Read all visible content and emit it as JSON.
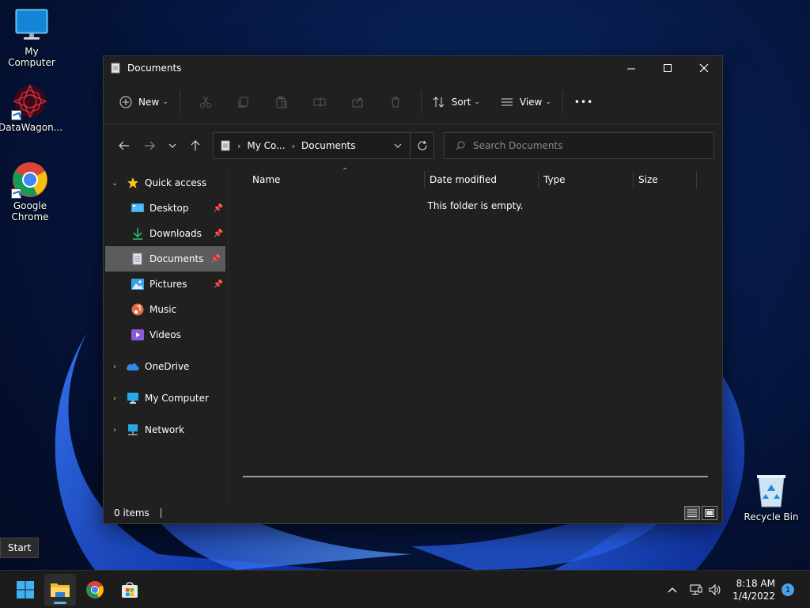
{
  "desktop": {
    "icons": [
      {
        "label": "My Computer",
        "icon": "monitor-icon"
      },
      {
        "label": "DataWagon...",
        "icon": "datawagon-icon"
      },
      {
        "label": "Google Chrome",
        "icon": "chrome-icon"
      },
      {
        "label": "Recycle Bin",
        "icon": "recycle-bin-icon"
      }
    ]
  },
  "window": {
    "title": "Documents",
    "toolbar": {
      "new_label": "New",
      "sort_label": "Sort",
      "view_label": "View",
      "more_label": "•••"
    },
    "address": {
      "segments": [
        "My Co...",
        "Documents"
      ]
    },
    "search": {
      "placeholder": "Search Documents"
    },
    "nav": {
      "quick_access": "Quick access",
      "items": [
        {
          "label": "Desktop",
          "pinned": true
        },
        {
          "label": "Downloads",
          "pinned": true
        },
        {
          "label": "Documents",
          "pinned": true,
          "selected": true
        },
        {
          "label": "Pictures",
          "pinned": true
        },
        {
          "label": "Music",
          "pinned": false
        },
        {
          "label": "Videos",
          "pinned": false
        }
      ],
      "onedrive": "OneDrive",
      "my_computer": "My Computer",
      "network": "Network"
    },
    "columns": [
      "Name",
      "Date modified",
      "Type",
      "Size"
    ],
    "empty_message": "This folder is empty.",
    "status": {
      "items_count": "0 items"
    }
  },
  "tooltip": {
    "text": "Start"
  },
  "taskbar": {
    "apps": [
      "start-icon",
      "file-explorer-icon",
      "chrome-icon",
      "store-icon"
    ],
    "clock": {
      "time": "8:18 AM",
      "date": "1/4/2022"
    },
    "notification_count": "1"
  },
  "colors": {
    "window_bg": "#202020",
    "selected_nav": "#5c5c5c",
    "taskbar_bg": "#1c1c1c",
    "accent": "#4ca0e6"
  }
}
